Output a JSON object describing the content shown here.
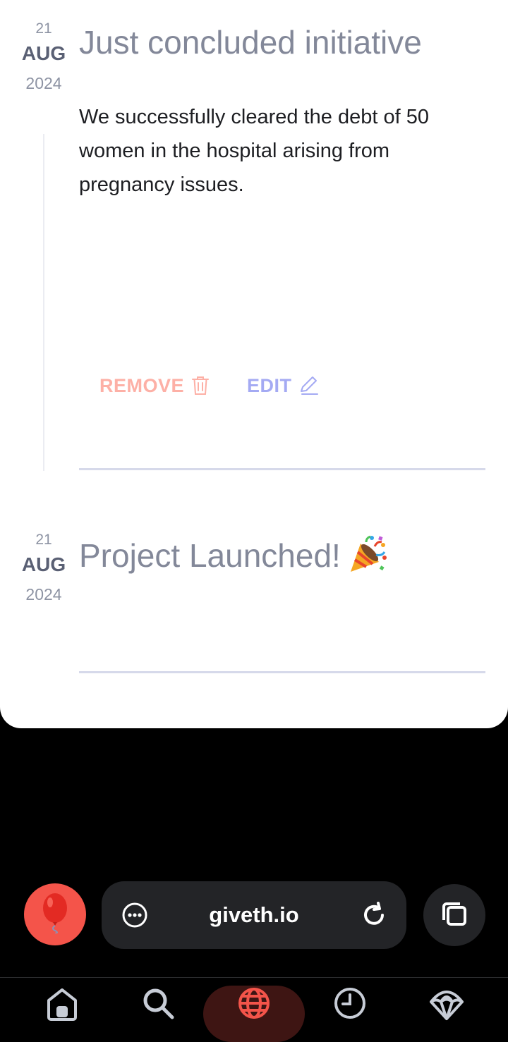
{
  "updates": [
    {
      "day": "21",
      "month": "AUG",
      "year": "2024",
      "title": "Just concluded initiative",
      "description": "We successfully cleared the debt of 50 women in the hospital arising from pregnancy issues.",
      "remove_label": "REMOVE",
      "edit_label": "EDIT"
    },
    {
      "day": "21",
      "month": "AUG",
      "year": "2024",
      "title": "Project Launched!"
    }
  ],
  "browser": {
    "url": "giveth.io"
  },
  "icons": {
    "remove": "trash-icon",
    "edit": "pencil-icon",
    "launch": "party-popper-icon",
    "balloon": "balloon-icon",
    "menu": "more-dots-icon",
    "reload": "reload-icon",
    "tabs": "tabs-icon",
    "nav": [
      "home-icon",
      "search-icon",
      "globe-icon",
      "clock-icon",
      "parachute-icon"
    ]
  },
  "colors": {
    "remove": "#fdb0a6",
    "edit": "#a4aaf3",
    "accent": "#f4544a",
    "nav_active_bg": "#3e1513"
  }
}
